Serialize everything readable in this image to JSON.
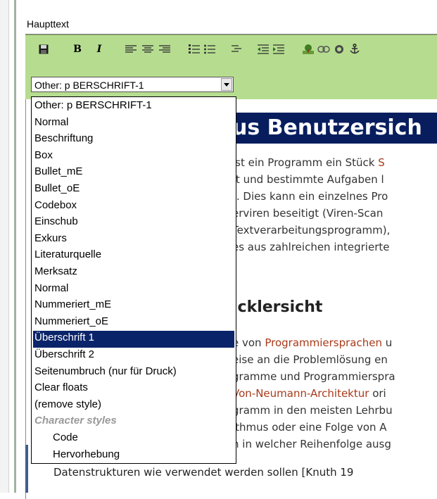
{
  "field_label": "Haupttext",
  "toolbar": {
    "bold": "B",
    "italic": "I",
    "format_select_value": "Other: p BERSCHRIFT-1"
  },
  "content": {
    "heading1": "us Benutzersich",
    "paragraph_lines": [
      {
        "text": "ist ein Programm ein Stück ",
        "link": "S"
      },
      {
        "text": "ft und bestimmte Aufgaben l",
        "link": ""
      },
      {
        "text": "t. Dies kann ein einzelnes Pro",
        "link": ""
      },
      {
        "text": "erviren beseitigt (Viren-Scan",
        "link": ""
      },
      {
        "text": "Textverarbeitungsprogramm),",
        "link": ""
      },
      {
        "text": "es aus zahlreichen integrierte",
        "link": ""
      }
    ],
    "heading2": "icklersicht",
    "paragraph2_lines": [
      {
        "pre": "e von ",
        "link": "Programmiersprachen",
        "post": " u"
      },
      {
        "pre": "eise an die Problemlösung en",
        "link": "",
        "post": ""
      },
      {
        "pre": "gramme und Programmierspra",
        "link": "",
        "post": ""
      },
      {
        "pre": "",
        "link": "Von-Neumann-Architektur",
        "post": " ori"
      },
      {
        "pre": "gramm in den meisten Lehrbu",
        "link": "",
        "post": ""
      },
      {
        "pre": "ithmus oder eine Folge von A",
        "link": "",
        "post": ""
      },
      {
        "pre": "n in welcher Reihenfolge ausg",
        "link": "",
        "post": ""
      }
    ],
    "last_line": "Datenstrukturen wie verwendet werden sollen [Knuth 19"
  },
  "dropdown": {
    "options": [
      {
        "label": "Other: p BERSCHRIFT-1",
        "kind": "normal"
      },
      {
        "label": "Normal",
        "kind": "normal"
      },
      {
        "label": "Beschriftung",
        "kind": "normal"
      },
      {
        "label": "Box",
        "kind": "normal"
      },
      {
        "label": "Bullet_mE",
        "kind": "normal"
      },
      {
        "label": "Bullet_oE",
        "kind": "normal"
      },
      {
        "label": "Codebox",
        "kind": "normal"
      },
      {
        "label": "Einschub",
        "kind": "normal"
      },
      {
        "label": "Exkurs",
        "kind": "normal"
      },
      {
        "label": "Literaturquelle",
        "kind": "normal"
      },
      {
        "label": "Merksatz",
        "kind": "normal"
      },
      {
        "label": "Normal",
        "kind": "normal"
      },
      {
        "label": "Nummeriert_mE",
        "kind": "normal"
      },
      {
        "label": "Nummeriert_oE",
        "kind": "normal"
      },
      {
        "label": "Überschrift 1",
        "kind": "selected"
      },
      {
        "label": "Überschrift 2",
        "kind": "normal"
      },
      {
        "label": "Seitenumbruch (nur für Druck)",
        "kind": "normal"
      },
      {
        "label": "Clear floats",
        "kind": "normal"
      },
      {
        "label": "(remove style)",
        "kind": "normal"
      },
      {
        "label": "Character styles",
        "kind": "group"
      },
      {
        "label": "Code",
        "kind": "sub"
      },
      {
        "label": "Hervorhebung",
        "kind": "sub"
      }
    ]
  },
  "colors": {
    "toolbar_bg": "#b6dd8f",
    "heading_bg": "#071d5e",
    "selection_bg": "#0a246a",
    "link": "#a83a1a"
  }
}
